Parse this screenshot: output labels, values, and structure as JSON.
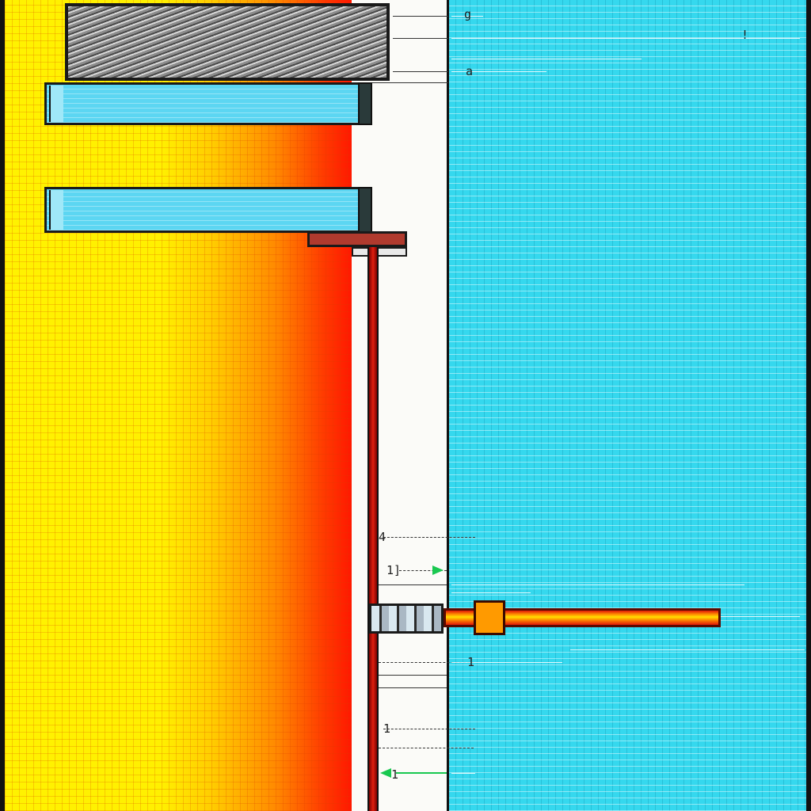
{
  "labels": {
    "top_right_1": "g",
    "top_right_2": "!",
    "upper_mark": "a",
    "mid_left_1": "4",
    "mid_left_2": "1]",
    "low_left_1": "1",
    "low_left_2": "1",
    "bottom_left": "1"
  },
  "colors": {
    "hot_start": "#fff200",
    "hot_end": "#ff1800",
    "cold_zone": "#35d8ee",
    "rod": "#e02010",
    "arrow": "#19c850"
  }
}
